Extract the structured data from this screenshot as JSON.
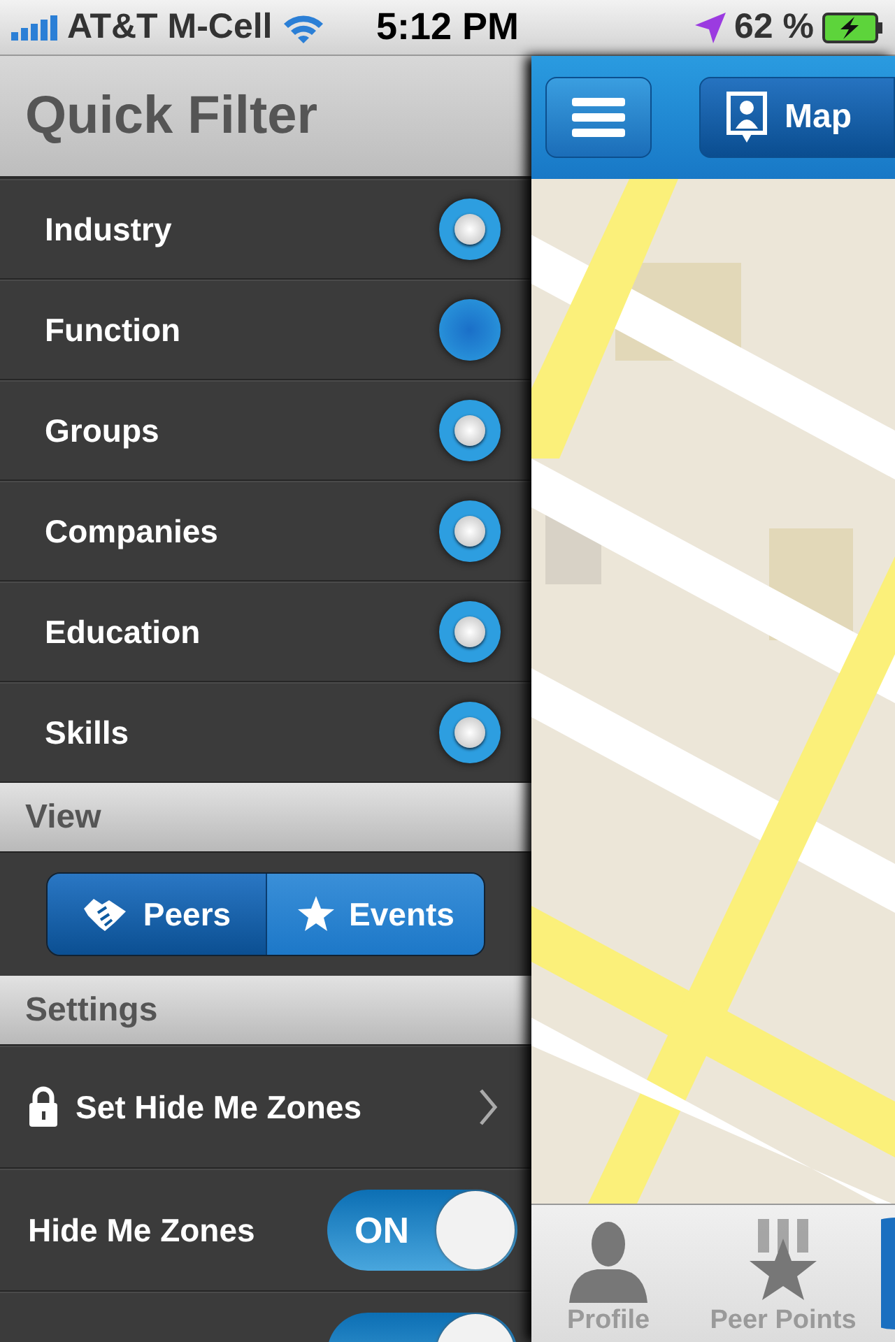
{
  "status_bar": {
    "carrier": "AT&T M-Cell",
    "time": "5:12 PM",
    "battery": "62 %"
  },
  "sidebar": {
    "title": "Quick Filter",
    "filters": [
      {
        "label": "Industry",
        "on": true
      },
      {
        "label": "Function",
        "on": false
      },
      {
        "label": "Groups",
        "on": true
      },
      {
        "label": "Companies",
        "on": true
      },
      {
        "label": "Education",
        "on": true
      },
      {
        "label": "Skills",
        "on": true
      }
    ],
    "view_header": "View",
    "view_options": [
      {
        "label": "Peers",
        "selected": true
      },
      {
        "label": "Events",
        "selected": false
      }
    ],
    "settings_header": "Settings",
    "settings": [
      {
        "kind": "link",
        "label": "Set Hide Me Zones"
      },
      {
        "kind": "switch",
        "label": "Hide Me Zones",
        "on": true,
        "state_text": "ON"
      },
      {
        "kind": "switch",
        "on": true
      }
    ]
  },
  "map_view": {
    "nav_button": "Map",
    "tabs": [
      {
        "label": "Profile",
        "selected": false
      },
      {
        "label": "Peer Points",
        "selected": false
      }
    ]
  }
}
